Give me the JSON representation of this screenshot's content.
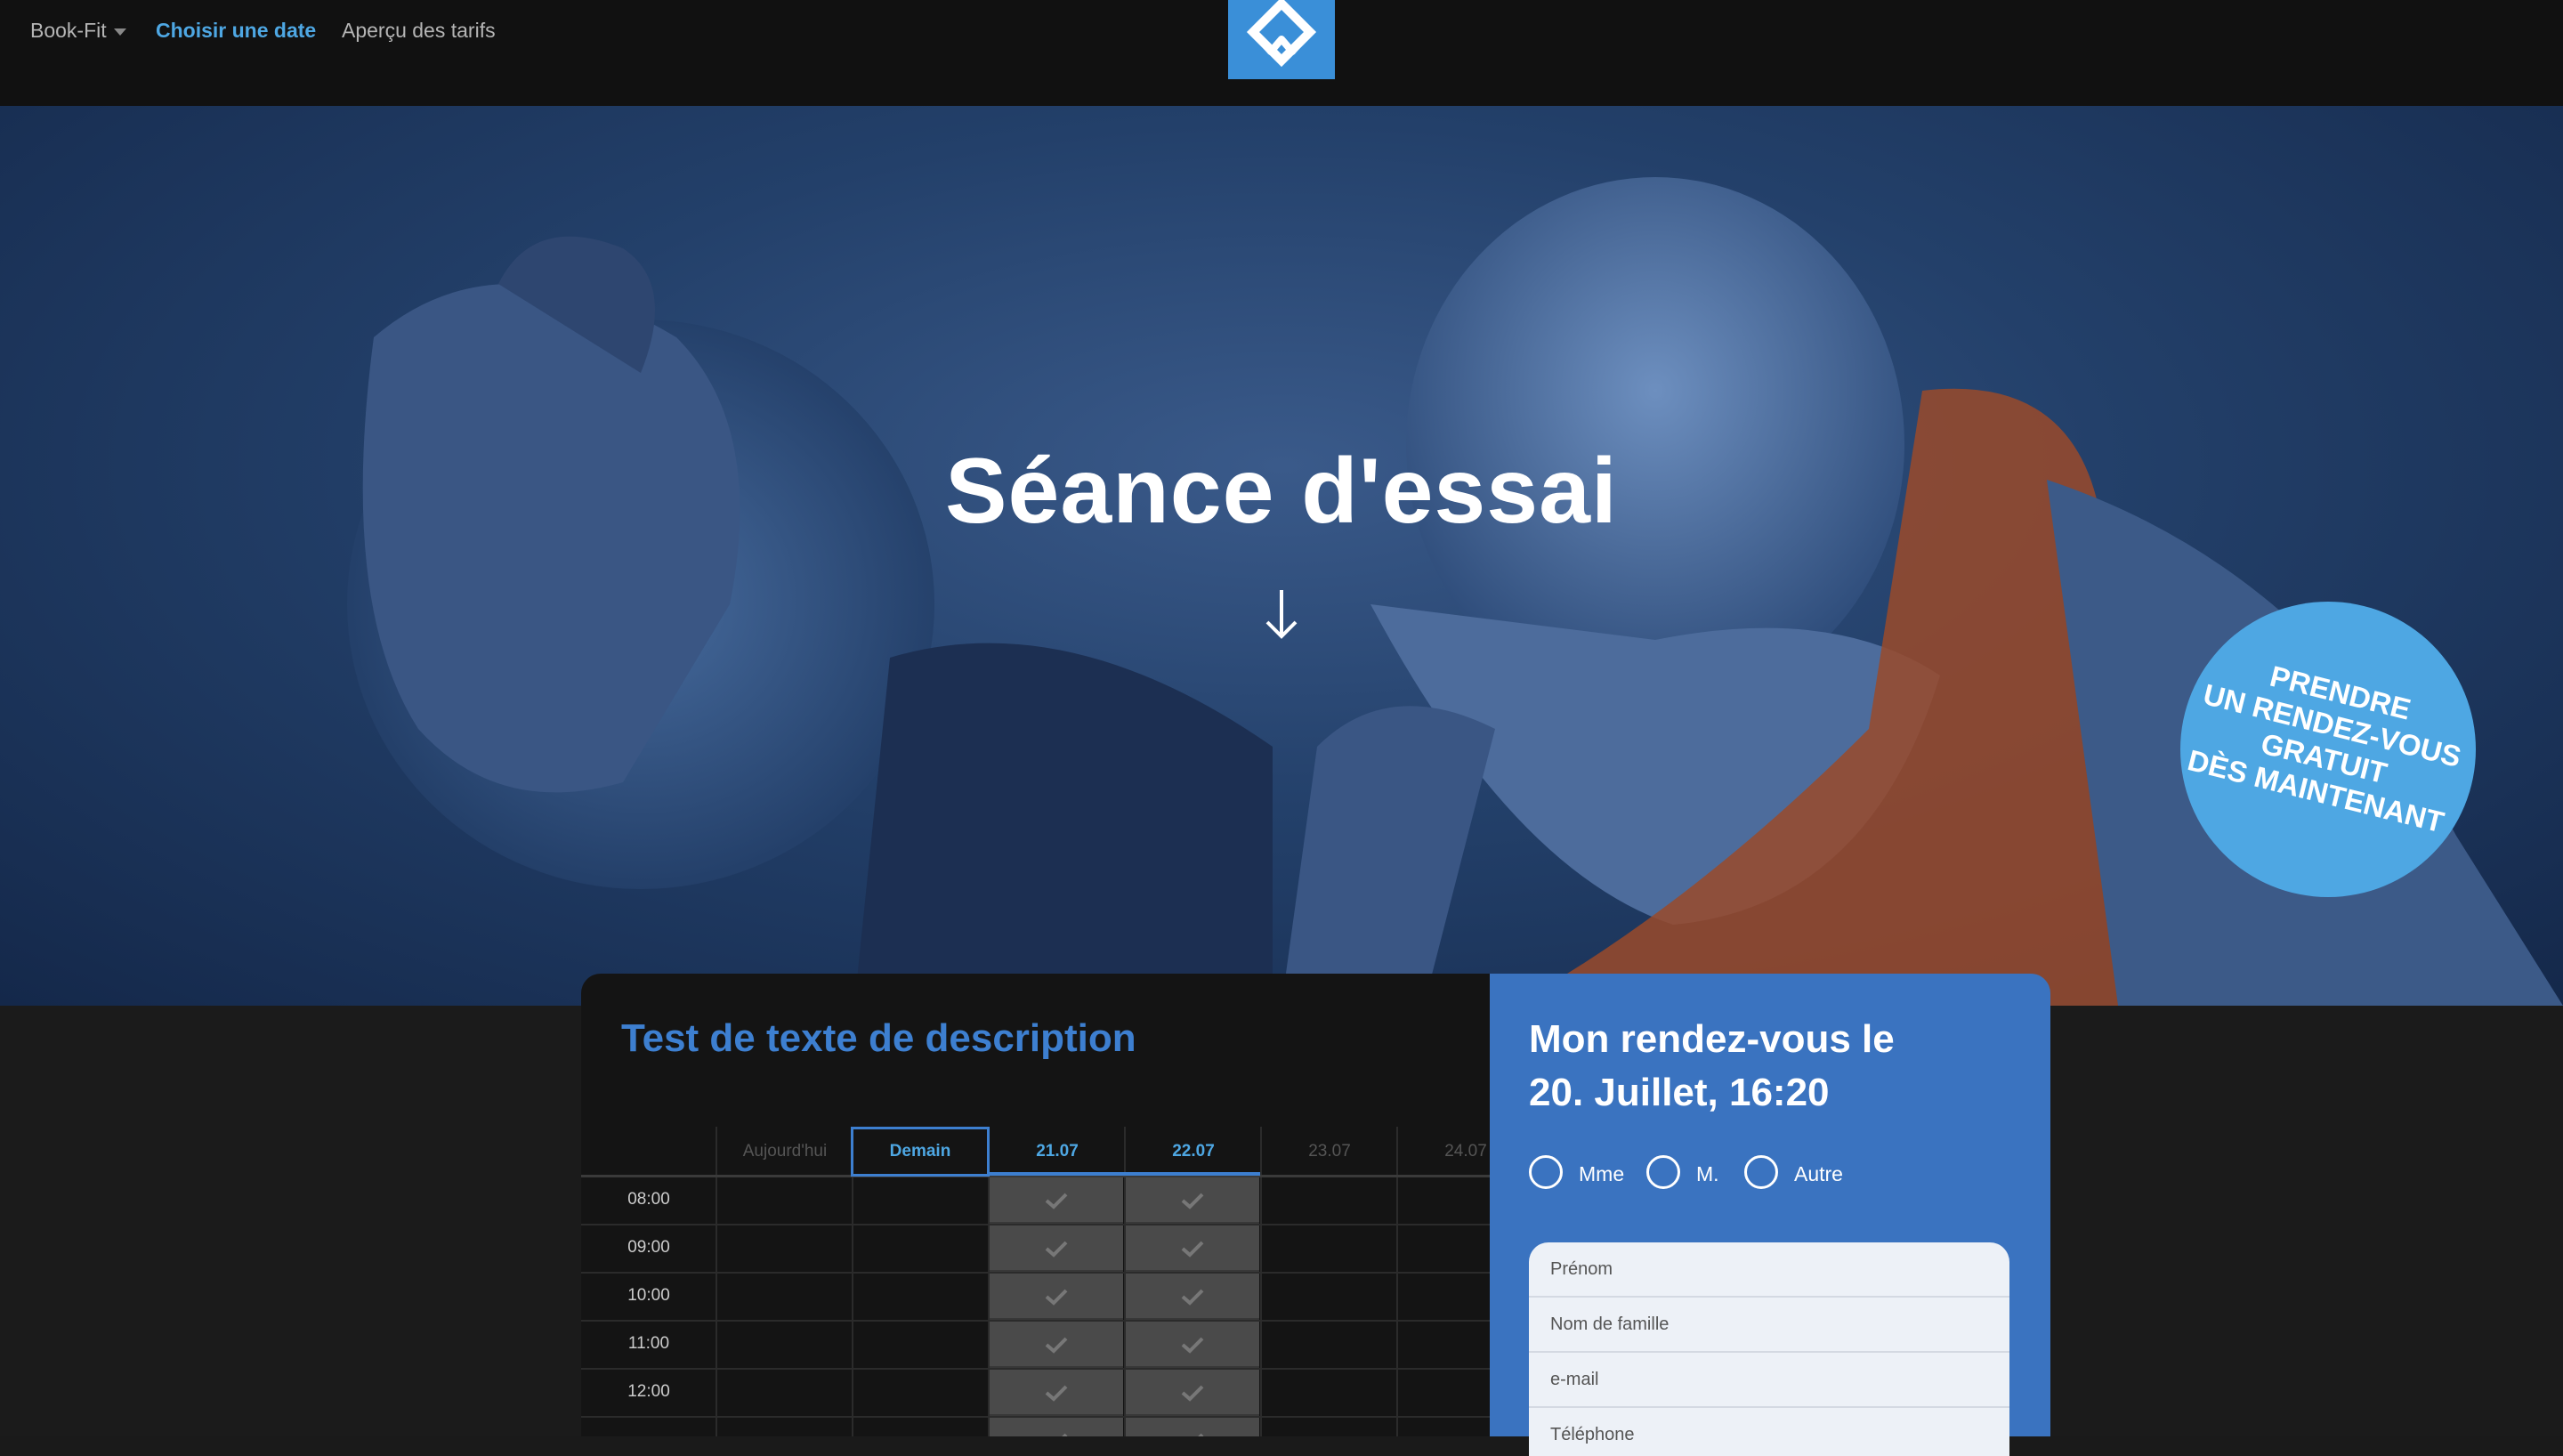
{
  "nav": {
    "brand_label": "Book-Fit",
    "choose_date_label": "Choisir une date",
    "pricing_label": "Aperçu des tarifs"
  },
  "hero": {
    "title": "Séance d'essai",
    "cta_lines": [
      "PRENDRE",
      "UN RENDEZ-VOUS",
      "GRATUIT",
      "DÈS MAINTENANT"
    ]
  },
  "schedule": {
    "description_title": "Test de texte de description",
    "days": [
      "Aujourd'hui",
      "Demain",
      "21.07",
      "22.07",
      "23.07",
      "24.07"
    ],
    "times": [
      "08:00",
      "09:00",
      "10:00",
      "11:00",
      "12:00"
    ]
  },
  "appointment": {
    "title_line1": "Mon rendez-vous le",
    "title_line2": "20. Juillet, 16:20",
    "salutations": [
      "Mme",
      "M.",
      "Autre"
    ],
    "fields": {
      "first_name_placeholder": "Prénom",
      "last_name_placeholder": "Nom de famille",
      "email_placeholder": "e-mail",
      "phone_placeholder": "Téléphone"
    }
  },
  "colors": {
    "accent": "#4ea7e3",
    "panel_blue": "#3a73c0",
    "nav_bg": "#111111"
  }
}
